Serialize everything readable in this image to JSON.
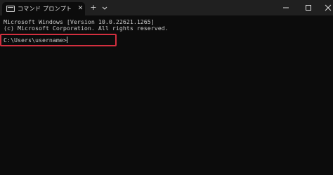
{
  "window": {
    "tab_title": "コマンド プロンプト",
    "tab_icon": "terminal-icon",
    "new_tab_label": "+",
    "close_tab_label": "✕",
    "controls": [
      "minimize-icon",
      "maximize-icon",
      "close-icon"
    ]
  },
  "console": {
    "line1": "Microsoft Windows [Version 10.0.22621.1265]",
    "line2": "(c) Microsoft Corporation. All rights reserved.",
    "prompt": "C:\\Users\\username>"
  },
  "colors": {
    "titlebar": "#202020",
    "background": "#0c0c0c",
    "text": "#cccccc",
    "highlight": "#d32f3f"
  }
}
